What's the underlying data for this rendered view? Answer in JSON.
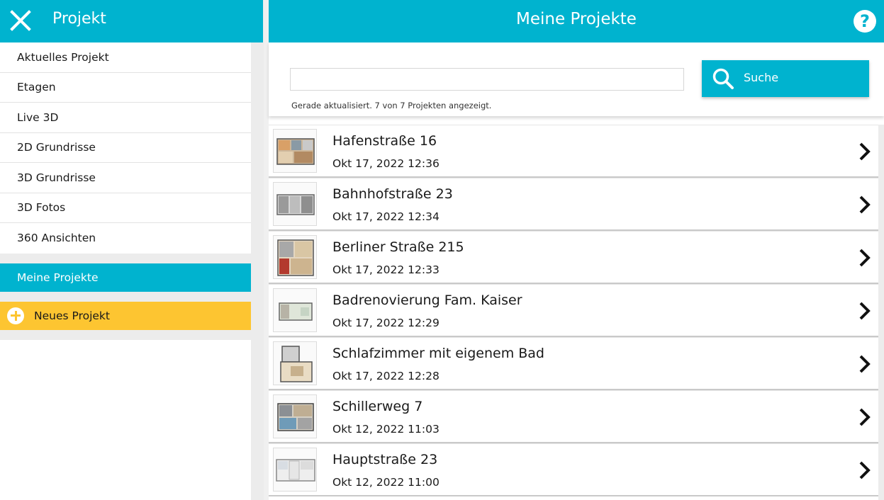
{
  "sidebar": {
    "title": "Projekt",
    "items": [
      {
        "label": "Aktuelles Projekt"
      },
      {
        "label": "Etagen"
      },
      {
        "label": "Live 3D"
      },
      {
        "label": "2D Grundrisse"
      },
      {
        "label": "3D Grundrisse"
      },
      {
        "label": "3D Fotos"
      },
      {
        "label": "360 Ansichten"
      }
    ],
    "active_item": "Meine Projekte",
    "new_project": "Neues Projekt"
  },
  "main": {
    "title": "Meine Projekte",
    "help_label": "?",
    "search": {
      "value": "",
      "placeholder": "",
      "button_label": "Suche",
      "status": "Gerade aktualisiert. 7 von 7 Projekten angezeigt."
    },
    "projects": [
      {
        "name": "Hafenstraße 16",
        "date": "Okt 17, 2022 12:36"
      },
      {
        "name": "Bahnhofstraße 23",
        "date": "Okt 17, 2022 12:34"
      },
      {
        "name": "Berliner Straße 215",
        "date": "Okt 17, 2022 12:33"
      },
      {
        "name": "Badrenovierung Fam. Kaiser",
        "date": "Okt 17, 2022 12:29"
      },
      {
        "name": "Schlafzimmer mit eigenem Bad",
        "date": "Okt 17, 2022 12:28"
      },
      {
        "name": "Schillerweg 7",
        "date": "Okt 12, 2022 11:03"
      },
      {
        "name": "Hauptstraße 23",
        "date": "Okt 12, 2022 11:00"
      }
    ]
  },
  "colors": {
    "accent": "#00b3cf",
    "new_project": "#fdc531"
  },
  "icons": {
    "close": "close-icon",
    "help": "help-icon",
    "search": "search-icon",
    "plus": "plus-icon",
    "chevron": "chevron-right-icon",
    "thumbnail": "floorplan-thumbnail"
  }
}
